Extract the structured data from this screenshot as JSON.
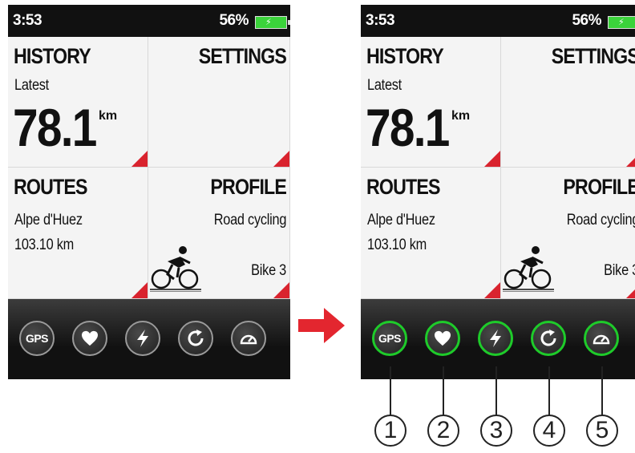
{
  "status": {
    "time": "3:53",
    "battery": "56%"
  },
  "history": {
    "title": "HISTORY",
    "subtitle": "Latest",
    "value": "78.1",
    "unit": "km"
  },
  "settings": {
    "title": "SETTINGS"
  },
  "routes": {
    "title": "ROUTES",
    "name": "Alpe d'Huez",
    "distance": "103.10 km"
  },
  "profile": {
    "title": "PROFILE",
    "type": "Road cycling",
    "bike": "Bike 3"
  },
  "toolbar": {
    "gps_label": "GPS",
    "icons": [
      "gps-icon",
      "heart-icon",
      "lightning-icon",
      "refresh-icon",
      "gauge-icon"
    ]
  },
  "callouts": [
    "1",
    "2",
    "3",
    "4",
    "5"
  ],
  "colors": {
    "accent_red": "#d9232e",
    "highlight_green": "#1ecb2a",
    "battery_green": "#3bd33b",
    "bar_dark": "#111111"
  }
}
